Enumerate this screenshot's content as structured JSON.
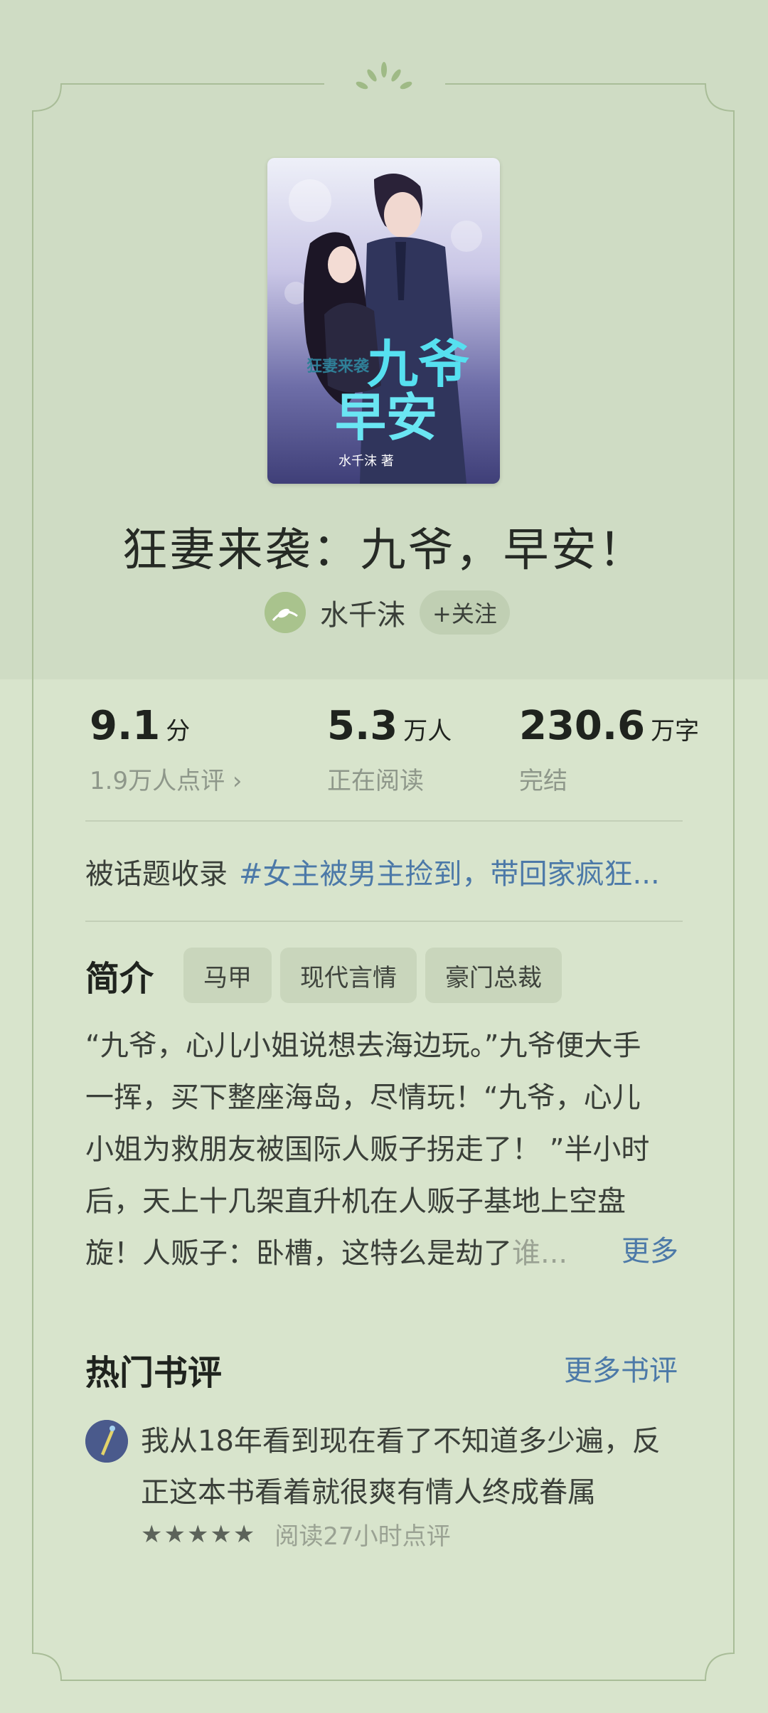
{
  "book": {
    "title": "狂妻来袭：九爷，早安！",
    "cover_title_small": "狂妻来袭",
    "cover_title_big_1": "九爷",
    "cover_title_big_2": "早安",
    "cover_author": "水千沫 著"
  },
  "author": {
    "name": "水千沫",
    "follow_label": "+关注"
  },
  "stats": {
    "score": {
      "value": "9.1",
      "unit": "分",
      "sub": "1.9万人点评 ›"
    },
    "readers": {
      "value": "5.3",
      "unit": "万人",
      "sub": "正在阅读"
    },
    "words": {
      "value": "230.6",
      "unit": "万字",
      "sub": "完结"
    }
  },
  "topic": {
    "label": "被话题收录",
    "link": "#女主被男主捡到，带回家疯狂..."
  },
  "intro": {
    "title": "简介",
    "tags": [
      "马甲",
      "现代言情",
      "豪门总裁"
    ],
    "lines": [
      "“九爷，心儿小姐说想去海边玩。”九爷便大手",
      "一挥，买下整座海岛，尽情玩！“九爷，心儿",
      "小姐为救朋友被国际人贩子拐走了！ ”半小时",
      "后，天上十几架直升机在人贩子基地上空盘"
    ],
    "last_line": "旋！人贩子：卧槽，这特么是劫了",
    "last_line_fade": "谁...",
    "more": "更多"
  },
  "reviews": {
    "title": "热门书评",
    "more": "更多书评",
    "items": [
      {
        "lines": [
          "我从18年看到现在看了不知道多少遍，反",
          "正这本书看着就很爽有情人终成眷属"
        ],
        "stars": "★★★★★",
        "rating": 5,
        "info": "阅读27小时点评"
      }
    ]
  },
  "colors": {
    "background": "#d8e4cc",
    "header_band": "#cfdcc4",
    "link": "#4c79a8",
    "frame_line": "#a9bd98"
  }
}
